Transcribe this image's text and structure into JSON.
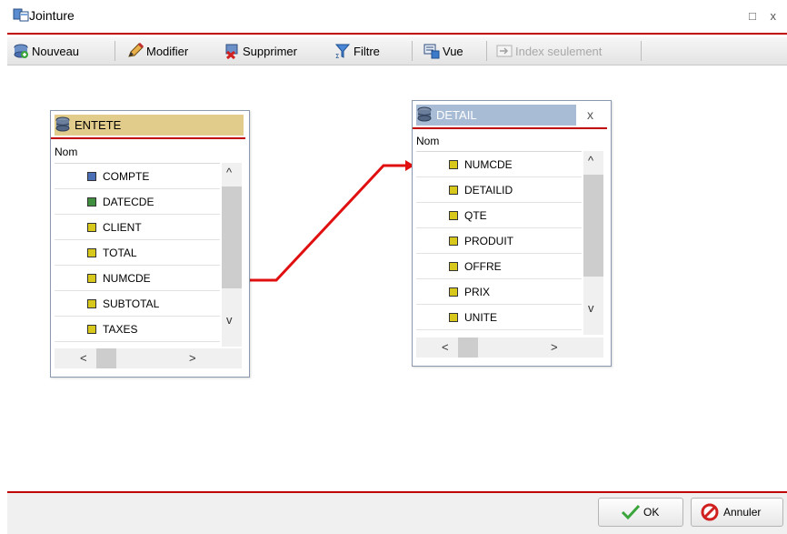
{
  "window": {
    "title": "Jointure",
    "maximize_glyph": "□",
    "close_glyph": "x"
  },
  "toolbar": {
    "nouveau": "Nouveau",
    "modifier": "Modifier",
    "supprimer": "Supprimer",
    "filtre": "Filtre",
    "vue": "Vue",
    "index_seulement": "Index seulement"
  },
  "tables": {
    "entete": {
      "name": "ENTETE",
      "column_header": "Nom",
      "fields": [
        "COMPTE",
        "DATECDE",
        "CLIENT",
        "TOTAL",
        "NUMCDE",
        "SUBTOTAL",
        "TAXES"
      ],
      "key_colors": [
        "#4a6fb5",
        "#3f8f3f",
        "#d8c81c",
        "#d8c81c",
        "#d8c81c",
        "#d8c81c",
        "#d8c81c"
      ]
    },
    "detail": {
      "name": "DETAIL",
      "column_header": "Nom",
      "close_glyph": "x",
      "fields": [
        "NUMCDE",
        "DETAILID",
        "QTE",
        "PRODUIT",
        "OFFRE",
        "PRIX",
        "UNITE"
      ],
      "key_colors": [
        "#d8c81c",
        "#d8c81c",
        "#d8c81c",
        "#d8c81c",
        "#d8c81c",
        "#d8c81c",
        "#d8c81c"
      ]
    }
  },
  "scroll_glyphs": {
    "up": "^",
    "down": "v",
    "left": "<",
    "right": ">"
  },
  "join": {
    "from": "ENTETE",
    "to": "DETAIL",
    "line_color": "#e01010"
  },
  "footer": {
    "ok": "OK",
    "annuler": "Annuler"
  },
  "colors": {
    "accent_red": "#c00000",
    "entete_header_bg": "#e2cc8c",
    "detail_header_bg": "#a9bcd6"
  }
}
